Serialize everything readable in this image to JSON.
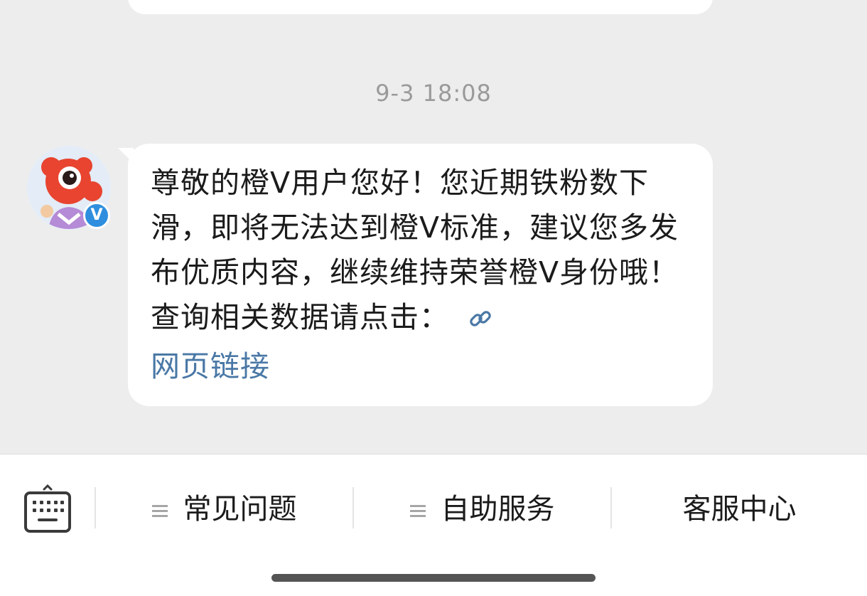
{
  "chat": {
    "timestamp": "9-3 18:08",
    "message": {
      "text": "尊敬的橙V用户您好！您近期铁粉数下滑，即将无法达到橙V标准，建议您多发布优质内容，继续维持荣誉橙V身份哦！查询相关数据请点击：",
      "link_icon": "link-icon",
      "link_text": "网页链接",
      "link_color": "#4a78a6"
    },
    "sender": {
      "avatar_icon": "mascot-avatar",
      "badge_label": "V",
      "badge_color": "#2f8fde"
    }
  },
  "bottom_bar": {
    "keyboard_icon": "keyboard-icon",
    "menu_items": [
      {
        "label": "常见问题",
        "icon": "menu-lines-icon"
      },
      {
        "label": "自助服务",
        "icon": "menu-lines-icon"
      },
      {
        "label": "客服中心"
      }
    ]
  },
  "colors": {
    "background": "#ededed",
    "bubble": "#ffffff",
    "accent": "#e84430"
  }
}
